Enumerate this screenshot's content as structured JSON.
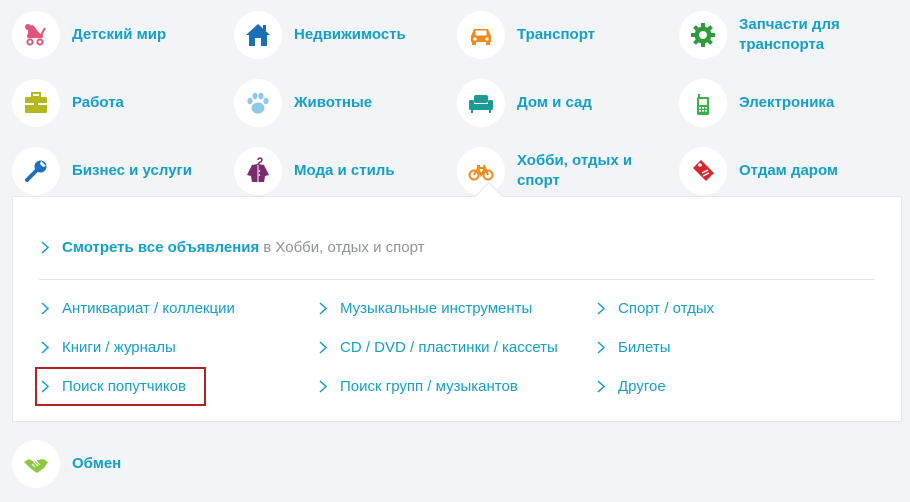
{
  "categories": [
    {
      "label": "Детский мир",
      "icon": "stroller-icon",
      "color": "#e0567a"
    },
    {
      "label": "Недвижимость",
      "icon": "house-icon",
      "color": "#1a6fb5"
    },
    {
      "label": "Транспорт",
      "icon": "car-icon",
      "color": "#f08a1c"
    },
    {
      "label": "Запчасти для\nтранспорта",
      "icon": "gear-icon",
      "color": "#2e9c3a"
    },
    {
      "label": "Работа",
      "icon": "briefcase-icon",
      "color": "#b5b81c"
    },
    {
      "label": "Животные",
      "icon": "paw-icon",
      "color": "#8ec9e8"
    },
    {
      "label": "Дом и сад",
      "icon": "sofa-icon",
      "color": "#1c9b95"
    },
    {
      "label": "Электроника",
      "icon": "phone-icon",
      "color": "#3cae4a"
    },
    {
      "label": "Бизнес и услуги",
      "icon": "wrench-icon",
      "color": "#1e6fc0"
    },
    {
      "label": "Мода и стиль",
      "icon": "coat-icon",
      "color": "#7b2a6e"
    },
    {
      "label": "Хобби, отдых и\nспорт",
      "icon": "bicycle-icon",
      "color": "#f08a1c"
    },
    {
      "label": "Отдам даром",
      "icon": "price-tag-icon",
      "color": "#d9262c"
    },
    {
      "label": "Обмен",
      "icon": "handshake-icon",
      "color": "#8dc63f"
    }
  ],
  "panel": {
    "view_all_link": "Смотреть все объявления",
    "view_all_in": "в Хобби, отдых и спорт",
    "subcategories": [
      "Антиквариат / коллекции",
      "Музыкальные инструменты",
      "Спорт / отдых",
      "Книги / журналы",
      "CD / DVD / пластинки / кассеты",
      "Билеты",
      "Поиск попутчиков",
      "Поиск групп / музыкантов",
      "Другое"
    ]
  },
  "colors": {
    "link": "#14a0c5",
    "muted": "#8f9498",
    "highlight": "#b22222",
    "background": "#f2f4f5"
  }
}
